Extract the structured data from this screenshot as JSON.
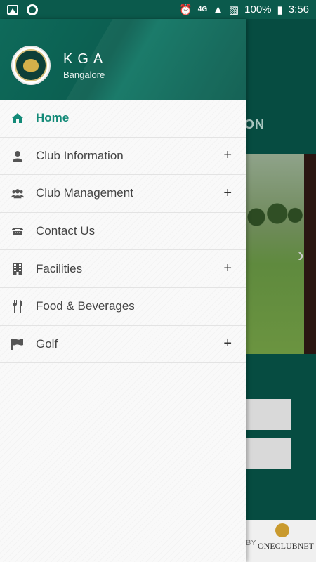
{
  "status_bar": {
    "battery": "100%",
    "time": "3:56",
    "network": "4G"
  },
  "drawer": {
    "club_name": "KGA",
    "club_city": "Bangalore",
    "menu": [
      {
        "label": "Home",
        "icon": "home-icon",
        "expandable": false,
        "active": true
      },
      {
        "label": "Club Information",
        "icon": "user-icon",
        "expandable": true,
        "active": false
      },
      {
        "label": "Club Management",
        "icon": "group-icon",
        "expandable": true,
        "active": false
      },
      {
        "label": "Contact Us",
        "icon": "phone-icon",
        "expandable": false,
        "active": false
      },
      {
        "label": "Facilities",
        "icon": "building-icon",
        "expandable": true,
        "active": false
      },
      {
        "label": "Food & Beverages",
        "icon": "cutlery-icon",
        "expandable": false,
        "active": false
      },
      {
        "label": "Golf",
        "icon": "flag-icon",
        "expandable": true,
        "active": false
      }
    ],
    "expand_symbol": "+"
  },
  "background": {
    "header_fragment": "ON",
    "footer_by": "BY",
    "footer_brand": "ONECLUBNET"
  },
  "colors": {
    "accent": "#138a78",
    "header_bg": "#0b5e50"
  }
}
